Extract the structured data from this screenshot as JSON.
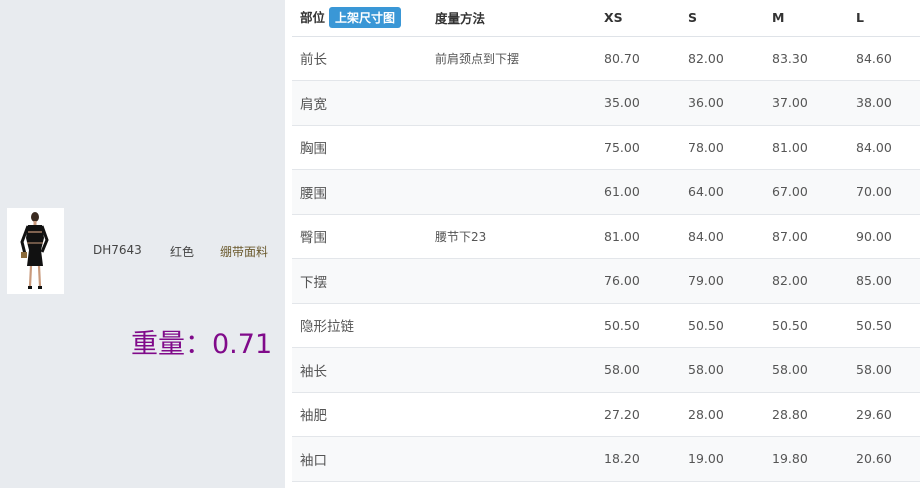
{
  "product": {
    "sku": "DH7643",
    "color_name": "红色",
    "fabric": "绷带面料",
    "weight_text": "重量：0.71",
    "thumbnail_icon": "dress-product-photo"
  },
  "table": {
    "headers": {
      "part": "部位",
      "badge": "上架尺寸图",
      "method": "度量方法",
      "sizes": [
        "XS",
        "S",
        "M",
        "L"
      ]
    },
    "rows": [
      {
        "part": "前长",
        "method": "前肩颈点到下摆",
        "values": [
          "80.70",
          "82.00",
          "83.30",
          "84.60"
        ]
      },
      {
        "part": "肩宽",
        "method": "",
        "values": [
          "35.00",
          "36.00",
          "37.00",
          "38.00"
        ]
      },
      {
        "part": "胸围",
        "method": "",
        "values": [
          "75.00",
          "78.00",
          "81.00",
          "84.00"
        ]
      },
      {
        "part": "腰围",
        "method": "",
        "values": [
          "61.00",
          "64.00",
          "67.00",
          "70.00"
        ]
      },
      {
        "part": "臀围",
        "method": "腰节下23",
        "values": [
          "81.00",
          "84.00",
          "87.00",
          "90.00"
        ]
      },
      {
        "part": "下摆",
        "method": "",
        "values": [
          "76.00",
          "79.00",
          "82.00",
          "85.00"
        ]
      },
      {
        "part": "隐形拉链",
        "method": "",
        "values": [
          "50.50",
          "50.50",
          "50.50",
          "50.50"
        ]
      },
      {
        "part": "袖长",
        "method": "",
        "values": [
          "58.00",
          "58.00",
          "58.00",
          "58.00"
        ]
      },
      {
        "part": "袖肥",
        "method": "",
        "values": [
          "27.20",
          "28.00",
          "28.80",
          "29.60"
        ]
      },
      {
        "part": "袖口",
        "method": "",
        "values": [
          "18.20",
          "19.00",
          "19.80",
          "20.60"
        ]
      }
    ]
  },
  "colors": {
    "badge_bg": "#3a97d6",
    "weight_text": "#800a8a",
    "panel_bg": "#e8ebef"
  }
}
